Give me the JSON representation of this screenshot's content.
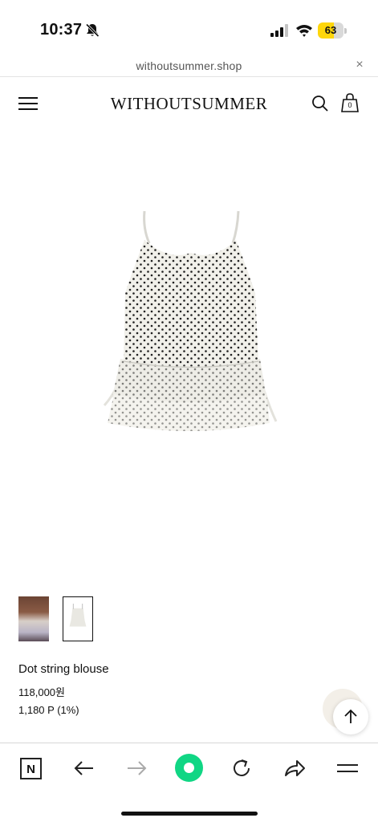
{
  "status_bar": {
    "time": "10:37",
    "battery_level": 63,
    "battery_label": "63",
    "battery_color": "#ffd60a",
    "icons": [
      "bell-slash-icon",
      "cellular-signal-icon",
      "wifi-icon",
      "battery-icon"
    ]
  },
  "browser": {
    "url": "withoutsummer.shop",
    "close_symbol": "×"
  },
  "header": {
    "logo": "WITHOUTSUMMER",
    "cart_count": "0",
    "icons": [
      "menu-icon",
      "search-icon",
      "shopping-bag-icon"
    ]
  },
  "product": {
    "name": "Dot string blouse",
    "price": "118,000원",
    "points": "1,180 P (1%)",
    "image_icon": "dot-camisole-blouse-image"
  },
  "thumbnails": [
    "model-photo-thumbnail",
    "product-photo-thumbnail"
  ],
  "toolbar": {
    "n_label": "N",
    "accent": "#10d684",
    "icons": [
      "n-logo-icon",
      "back-arrow-icon",
      "forward-arrow-icon",
      "green-circle-icon",
      "reload-icon",
      "share-icon",
      "hamburger-menu-icon"
    ]
  }
}
